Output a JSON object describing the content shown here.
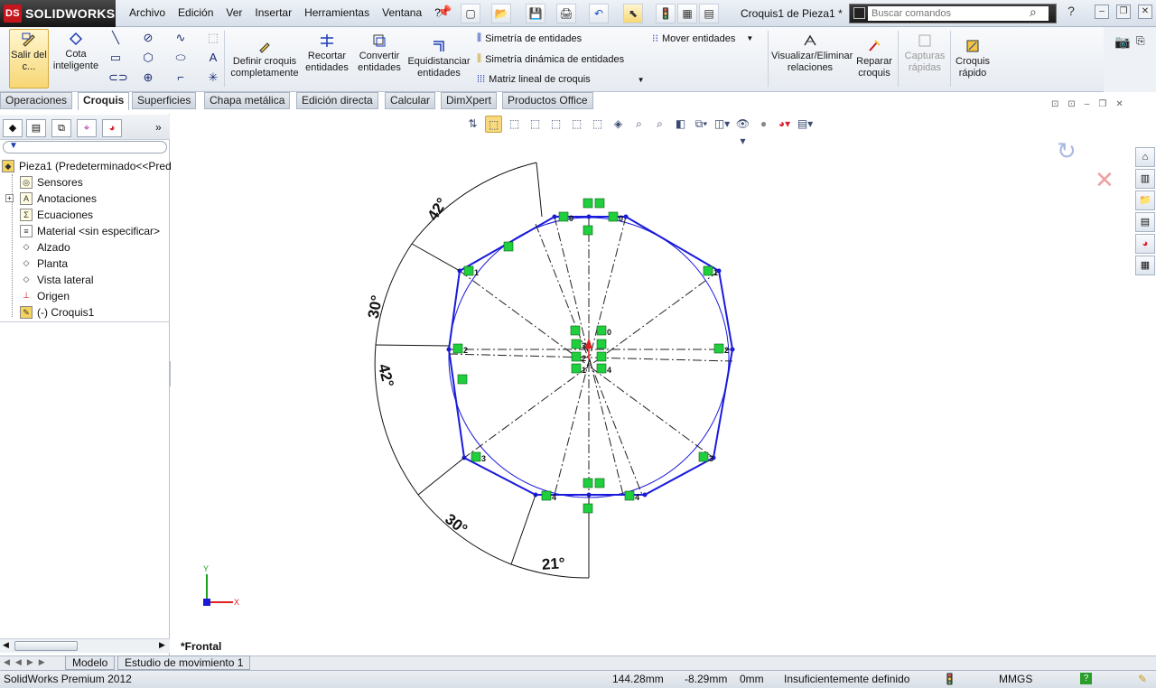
{
  "app": {
    "logo": "SOLIDWORKS",
    "logo_mark": "DS",
    "document_title": "Croquis1 de Pieza1 *"
  },
  "menu": [
    "Archivo",
    "Edición",
    "Ver",
    "Insertar",
    "Herramientas",
    "Ventana",
    "?"
  ],
  "quick_access": {
    "new_label": "▢",
    "open_label": "📂",
    "save_label": "💾",
    "print_label": "🖨",
    "undo_label": "↶",
    "select_label": "⬉",
    "rebuild_label": "🚦",
    "options_label": "▤"
  },
  "search": {
    "placeholder": "Buscar comandos"
  },
  "window_controls": {
    "help": "?",
    "minimize": "–",
    "restore": "❐",
    "close": "✕"
  },
  "ribbon": {
    "exit_sketch": "Salir del c...",
    "smart_dimension": "Cota inteligente",
    "fully_define": "Definir croquis completamente",
    "trim": "Recortar entidades",
    "convert": "Convertir entidades",
    "offset": "Equidistanciar entidades",
    "mirror": "Simetría de entidades",
    "dynamic_mirror": "Simetría dinámica de entidades",
    "linear_pattern": "Matriz lineal de croquis",
    "move": "Mover entidades",
    "relations": "Visualizar/Eliminar relaciones",
    "repair": "Reparar croquis",
    "quick_snaps": "Capturas rápidas",
    "rapid_sketch": "Croquis rápido"
  },
  "tabs": [
    "Operaciones",
    "Croquis",
    "Superficies",
    "Chapa metálica",
    "Edición directa",
    "Calcular",
    "DimXpert",
    "Productos Office"
  ],
  "active_tab": "Croquis",
  "feature_tree": [
    {
      "label": "Pieza1  (Predeterminado<<Pred",
      "icon": "part-icon",
      "glyph": "◆"
    },
    {
      "label": "Sensores",
      "icon": "sensor-icon",
      "glyph": "◎"
    },
    {
      "label": "Anotaciones",
      "icon": "annotations-icon",
      "glyph": "A"
    },
    {
      "label": "Ecuaciones",
      "icon": "equations-icon",
      "glyph": "Σ"
    },
    {
      "label": "Material <sin especificar>",
      "icon": "material-icon",
      "glyph": "≡"
    },
    {
      "label": "Alzado",
      "icon": "plane-icon",
      "glyph": "◇"
    },
    {
      "label": "Planta",
      "icon": "plane-icon",
      "glyph": "◇"
    },
    {
      "label": "Vista lateral",
      "icon": "plane-icon",
      "glyph": "◇"
    },
    {
      "label": "Origen",
      "icon": "origin-icon",
      "glyph": "⊥"
    },
    {
      "label": "(-) Croquis1",
      "icon": "sketch-icon",
      "glyph": "✎"
    }
  ],
  "sketch": {
    "dimensions": [
      "42°",
      "30°",
      "42°",
      "30°",
      "21°"
    ],
    "vertex_labels": [
      "0",
      "0",
      "1",
      "1",
      "2",
      "2",
      "3",
      "3",
      "4",
      "4"
    ],
    "center_labels": [
      "0",
      "3",
      "2",
      "1",
      "4"
    ]
  },
  "triad": {
    "x": "X",
    "y": "Y"
  },
  "view_name": "*Frontal",
  "bottom_tabs": [
    "Modelo",
    "Estudio de movimiento 1"
  ],
  "status": {
    "product": "SolidWorks Premium 2012",
    "x": "144.28mm",
    "y": "-8.29mm",
    "z": "0mm",
    "state": "Insuficientemente definido",
    "units": "MMGS",
    "help": "?"
  },
  "colors": {
    "sketch_blue": "#1a1adc",
    "relation_green": "#1fcf3d",
    "ribbon_highlight": "#f7d774"
  }
}
